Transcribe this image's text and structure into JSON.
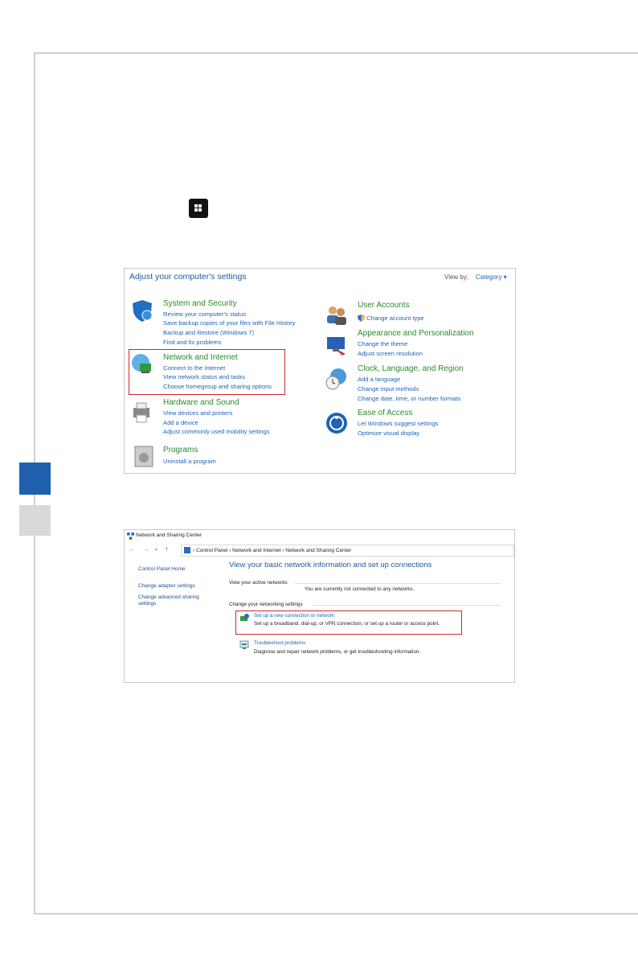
{
  "page": {
    "number": ""
  },
  "control_panel": {
    "title": "Adjust your computer's settings",
    "view_by_label": "View by:",
    "view_by_value": "Category ▾",
    "categories": [
      {
        "title": "System and Security",
        "links": [
          "Review your computer's status",
          "Save backup copies of your files with File History",
          "Backup and Restore (Windows 7)",
          "Find and fix problems"
        ]
      },
      {
        "title": "Network and Internet",
        "links": [
          "Connect to the Internet",
          "View network status and tasks",
          "Choose homegroup and sharing options"
        ]
      },
      {
        "title": "Hardware and Sound",
        "links": [
          "View devices and printers",
          "Add a device",
          "Adjust commonly used mobility settings"
        ]
      },
      {
        "title": "Programs",
        "links": [
          "Uninstall a program"
        ]
      },
      {
        "title": "User Accounts",
        "links": [
          "Change account type"
        ]
      },
      {
        "title": "Appearance and Personalization",
        "links": [
          "Change the theme",
          "Adjust screen resolution"
        ]
      },
      {
        "title": "Clock, Language, and Region",
        "links": [
          "Add a language",
          "Change input methods",
          "Change date, time, or number formats"
        ]
      },
      {
        "title": "Ease of Access",
        "links": [
          "Let Windows suggest settings",
          "Optimize visual display"
        ]
      }
    ]
  },
  "network_center": {
    "window_title": "Network and Sharing Center",
    "address": "›  Control Panel  ›  Network and Internet  ›  Network and Sharing Center",
    "sidebar": {
      "home": "Control Panel Home",
      "adapter": "Change adapter settings",
      "advanced_1": "Change advanced sharing",
      "advanced_2": "settings"
    },
    "heading": "View your basic network information and set up connections",
    "active_label": "View your active networks",
    "not_connected": "You are currently not connected to any networks.",
    "change_label": "Change your networking settings",
    "setup_link": "Set up a new connection or network",
    "setup_desc": "Set up a broadband, dial-up, or VPN connection; or set up a router or access point.",
    "troubleshoot_link": "Troubleshoot problems",
    "troubleshoot_desc": "Diagnose and repair network problems, or get troubleshooting information."
  },
  "colors": {
    "tab_active": "#1f5fae",
    "tab_inactive": "#d9d9d9",
    "highlight": "#d0262f",
    "link": "#1e63b8",
    "category": "#2a8a2a"
  }
}
